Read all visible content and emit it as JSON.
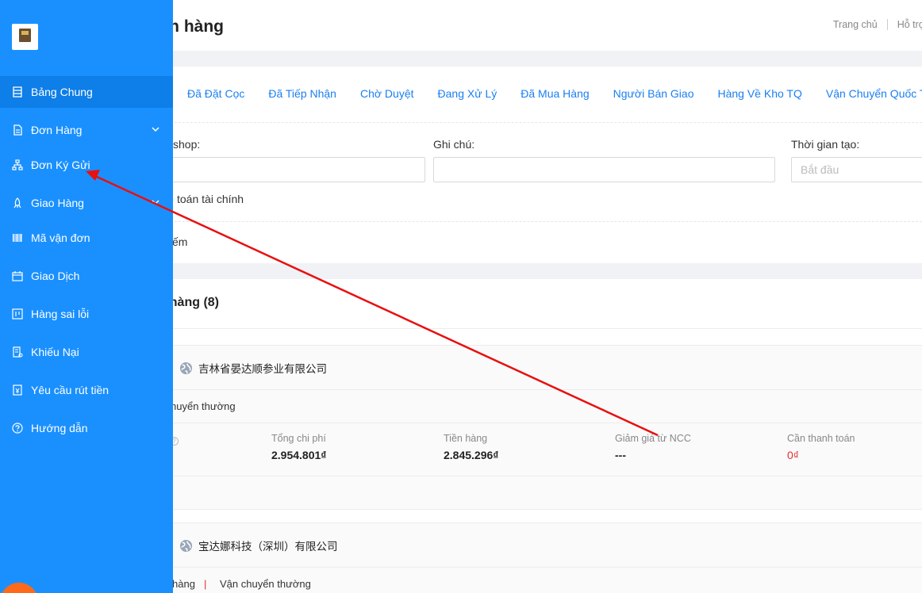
{
  "header": {
    "title": "n hàng",
    "links": [
      "Trang chủ",
      "Hỗ trợ"
    ]
  },
  "filters": {
    "status_tabs": [
      "Đã Đặt Cọc",
      "Đã Tiếp Nhận",
      "Chờ Duyệt",
      "Đang Xử Lý",
      "Đã Mua Hàng",
      "Người Bán Giao",
      "Hàng Về Kho TQ",
      "Vận Chuyển Quốc Tế"
    ],
    "shop_label": "shop:",
    "note_label": "Ghi chú:",
    "time_label": "Thời gian tạo:",
    "time_start_placeholder": "Bắt đầu",
    "finance_text": "toán tài chính",
    "search_text": "ếm"
  },
  "orders": {
    "title": "hàng (8)",
    "items": [
      {
        "shop": "吉林省晏达顺参业有限公司",
        "shipping": "huyển thường",
        "stats": [
          {
            "label": "Tổng chi phí",
            "value": "2.954.801₫"
          },
          {
            "label": "Tiền hàng",
            "value": "2.845.296₫"
          },
          {
            "label": "Giảm giá từ NCC",
            "value": "---"
          },
          {
            "label": "Cần thanh toán",
            "value": "0₫"
          }
        ]
      },
      {
        "shop": "宝达娜科技（深圳）有限公司",
        "shipping_left": "hàng",
        "shipping_sep": "|",
        "shipping": "Vận chuyển thường"
      }
    ]
  },
  "sidebar": {
    "items": [
      {
        "label": "Bảng Chung",
        "icon": "dashboard-icon"
      },
      {
        "label": "Đơn Hàng",
        "icon": "document-icon"
      },
      {
        "label": "Đơn Ký Gửi",
        "icon": "sitemap-icon"
      },
      {
        "label": "Giao Hàng",
        "icon": "rocket-icon"
      },
      {
        "label": "Mã vận đơn",
        "icon": "barcode-icon"
      },
      {
        "label": "Giao Dịch",
        "icon": "calendar-icon"
      },
      {
        "label": "Hàng sai lỗi",
        "icon": "board-icon"
      },
      {
        "label": "Khiếu Nại",
        "icon": "complaint-icon"
      },
      {
        "label": "Yêu cầu rút tiền",
        "icon": "withdraw-icon"
      },
      {
        "label": "Hướng dẫn",
        "icon": "help-icon"
      }
    ]
  },
  "colors": {
    "sidebar": "#1a90ff",
    "active_item": "#0e7ee8",
    "link": "#1a7ff0",
    "danger": "#e03030",
    "annotation_arrow": "#e81010"
  }
}
